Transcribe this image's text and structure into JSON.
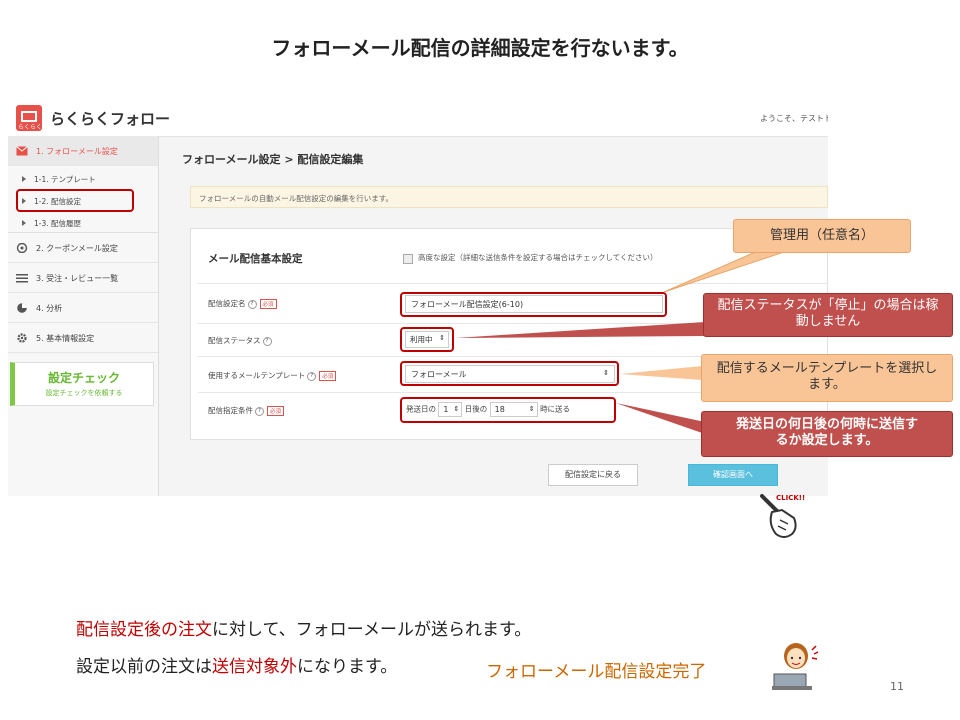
{
  "slide": {
    "title": "フォローメール配信の詳細設定を行ないます。",
    "page_number": "11"
  },
  "app": {
    "logo_text": "らくらくフォロー",
    "logo_kana": "らくらく",
    "welcome": "ようこそ、テストト"
  },
  "sidebar": {
    "items": [
      {
        "label": "1. フォローメール設定",
        "icon": "envelope-icon"
      },
      {
        "label": "2. クーポンメール設定",
        "icon": "coupon-icon"
      },
      {
        "label": "3. 受注・レビュー一覧",
        "icon": "list-icon"
      },
      {
        "label": "4. 分析",
        "icon": "pie-chart-icon"
      },
      {
        "label": "5. 基本情報設定",
        "icon": "gear-icon"
      }
    ],
    "sub_items": [
      {
        "label": "1-1. テンプレート"
      },
      {
        "label": "1-2. 配信設定"
      },
      {
        "label": "1-3. 配信履歴"
      }
    ],
    "check_button": {
      "title": "設定チェック",
      "subtitle": "設定チェックを依頼する"
    }
  },
  "main": {
    "breadcrumb": "フォローメール設定 > 配信設定編集",
    "info": "フォローメールの自動メール配信設定の編集を行います。",
    "panel_title": "メール配信基本設定",
    "advanced_checkbox_label": "高度な設定（詳細な送信条件を設定する場合はチェックしてください）",
    "fields": {
      "name_label": "配信設定名",
      "name_value": "フォローメール配信設定(6-10)",
      "status_label": "配信ステータス",
      "status_value": "利用中",
      "template_label": "使用するメールテンプレート",
      "template_value": "フォローメール",
      "condition_label": "配信指定条件",
      "cond_prefix": "発送日の",
      "cond_days": "1",
      "cond_mid": "日後の",
      "cond_hour": "18",
      "cond_suffix": "時に送る"
    },
    "required_badge": "必須",
    "help_glyph": "?",
    "back_button": "配信設定に戻る",
    "confirm_button": "確認画面へ",
    "click_label": "CLICK!!"
  },
  "callouts": {
    "name": "管理用（任意名）",
    "status": "配信ステータスが「停止」の場合は稼動しません",
    "template": "配信するメールテンプレートを選択します。",
    "condition": "発送日の何日後の何時に送信するか設定します。"
  },
  "footer": {
    "line1_red": "配信設定後の注文",
    "line1_rest": "に対して、フォローメールが送られます。",
    "line2_a": "設定以前の注文は",
    "line2_red": "送信対象外",
    "line2_b": "になります。",
    "done": "フォローメール配信設定完了"
  },
  "colors": {
    "highlight": "#c00000",
    "callout_orange": "#f9c597",
    "callout_red": "#c0504d",
    "confirm": "#5bc0de",
    "check_green": "#66b832"
  }
}
